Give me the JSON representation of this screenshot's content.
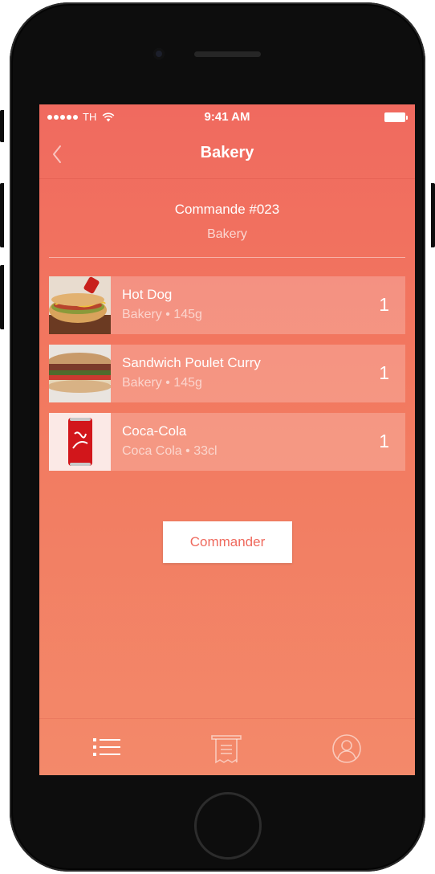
{
  "status_bar": {
    "carrier": "TH",
    "time": "9:41 AM"
  },
  "nav": {
    "title": "Bakery",
    "back_icon": "chevron-left-icon"
  },
  "order": {
    "number": "Commande #023",
    "store": "Bakery"
  },
  "items": [
    {
      "name": "Hot Dog",
      "subtitle": "Bakery • 145g",
      "quantity": "1",
      "image": "hot-dog-image"
    },
    {
      "name": "Sandwich Poulet Curry",
      "subtitle": "Bakery • 145g",
      "quantity": "1",
      "image": "sandwich-image"
    },
    {
      "name": "Coca-Cola",
      "subtitle": "Coca Cola • 33cl",
      "quantity": "1",
      "image": "coca-cola-can-image"
    }
  ],
  "actions": {
    "order_button": "Commander"
  },
  "tab_bar": {
    "tabs": [
      {
        "icon": "list-icon",
        "selected": true
      },
      {
        "icon": "receipt-icon",
        "selected": false
      },
      {
        "icon": "user-icon",
        "selected": false
      }
    ]
  },
  "colors": {
    "gradient_top": "#f06a5f",
    "gradient_bottom": "#f3896a",
    "button_text": "#ef6a5e"
  }
}
